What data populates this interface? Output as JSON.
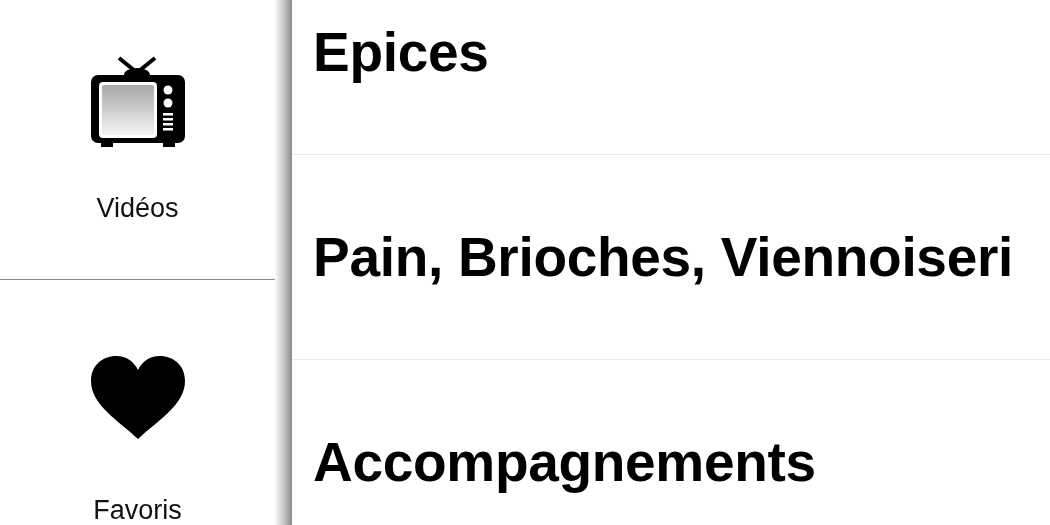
{
  "sidebar": {
    "items": [
      {
        "kind": "tv",
        "label": "Vidéos"
      },
      {
        "kind": "heart",
        "label": "Favoris"
      }
    ]
  },
  "categories": [
    {
      "label": "Epices"
    },
    {
      "label": "Pain, Brioches, Viennoiseri"
    },
    {
      "label": "Accompagnements"
    }
  ]
}
